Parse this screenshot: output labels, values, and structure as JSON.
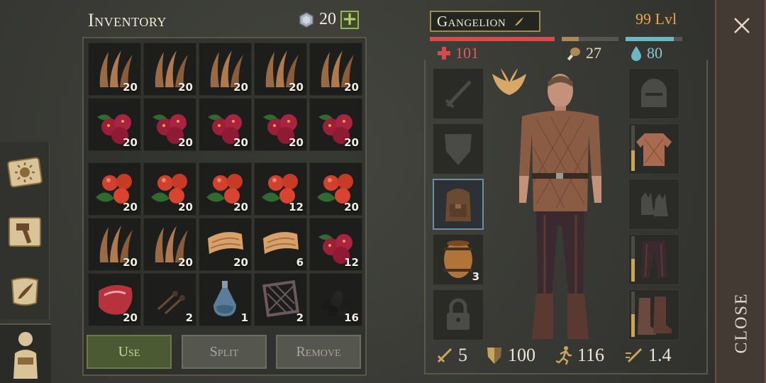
{
  "inventory": {
    "title": "Inventory",
    "currency_value": "20",
    "currency_icon": "gem-icon",
    "add_currency_label": "+",
    "slots": [
      {
        "item": "dried-fiber",
        "qty": "20"
      },
      {
        "item": "dried-fiber",
        "qty": "20"
      },
      {
        "item": "dried-fiber",
        "qty": "20"
      },
      {
        "item": "dried-fiber",
        "qty": "20"
      },
      {
        "item": "dried-fiber",
        "qty": "20"
      },
      {
        "item": "cranberries",
        "qty": "20"
      },
      {
        "item": "cranberries",
        "qty": "20"
      },
      {
        "item": "cranberries",
        "qty": "20"
      },
      {
        "item": "cranberries",
        "qty": "20"
      },
      {
        "item": "cranberries",
        "qty": "20"
      },
      {
        "item": "red-berries",
        "qty": "20"
      },
      {
        "item": "red-berries",
        "qty": "20"
      },
      {
        "item": "red-berries",
        "qty": "20"
      },
      {
        "item": "red-berries",
        "qty": "12"
      },
      {
        "item": "red-berries",
        "qty": "20"
      },
      {
        "item": "dried-fiber",
        "qty": "20"
      },
      {
        "item": "dried-fiber",
        "qty": "20"
      },
      {
        "item": "cloth",
        "qty": "20"
      },
      {
        "item": "cloth",
        "qty": "6"
      },
      {
        "item": "cranberries",
        "qty": "12"
      },
      {
        "item": "raw-meat",
        "qty": "20"
      },
      {
        "item": "nails",
        "qty": "2"
      },
      {
        "item": "flask",
        "qty": "1"
      },
      {
        "item": "iron-grate",
        "qty": "2"
      },
      {
        "item": "coal",
        "qty": "16"
      }
    ]
  },
  "actions": {
    "use_label": "Use",
    "split_label": "Split",
    "remove_label": "Remove"
  },
  "character": {
    "name": "Gangelion",
    "level": "99 Lvl",
    "health": "101",
    "hunger": "27",
    "thirst": "80",
    "health_fraction": 1.0,
    "hunger_fraction": 0.3,
    "thirst_fraction": 0.85,
    "left_equipment": [
      {
        "slot": "weapon",
        "icon": "sword-icon",
        "qty": ""
      },
      {
        "slot": "shield",
        "icon": "shield-icon",
        "qty": ""
      },
      {
        "slot": "backpack",
        "icon": "backpack-icon",
        "qty": ""
      },
      {
        "slot": "barrel",
        "icon": "barrel-icon",
        "qty": "3"
      },
      {
        "slot": "locked",
        "icon": "lock-icon",
        "qty": ""
      }
    ],
    "right_equipment": [
      {
        "slot": "helmet",
        "icon": "helmet-icon",
        "durability": null
      },
      {
        "slot": "chest",
        "icon": "jacket-icon",
        "durability": 0.45
      },
      {
        "slot": "gloves",
        "icon": "gloves-icon",
        "durability": null
      },
      {
        "slot": "legs",
        "icon": "pants-icon",
        "durability": 0.5
      },
      {
        "slot": "boots",
        "icon": "boots-icon",
        "durability": 0.5
      }
    ],
    "stats": {
      "attack": "5",
      "armor": "100",
      "speed": "116",
      "multiplier": "1.4"
    }
  },
  "close_label": "CLOSE",
  "colors": {
    "health": "#d94a4a",
    "hunger": "#b08a52",
    "thirst": "#6ab8c0",
    "level": "#e9a84a"
  }
}
